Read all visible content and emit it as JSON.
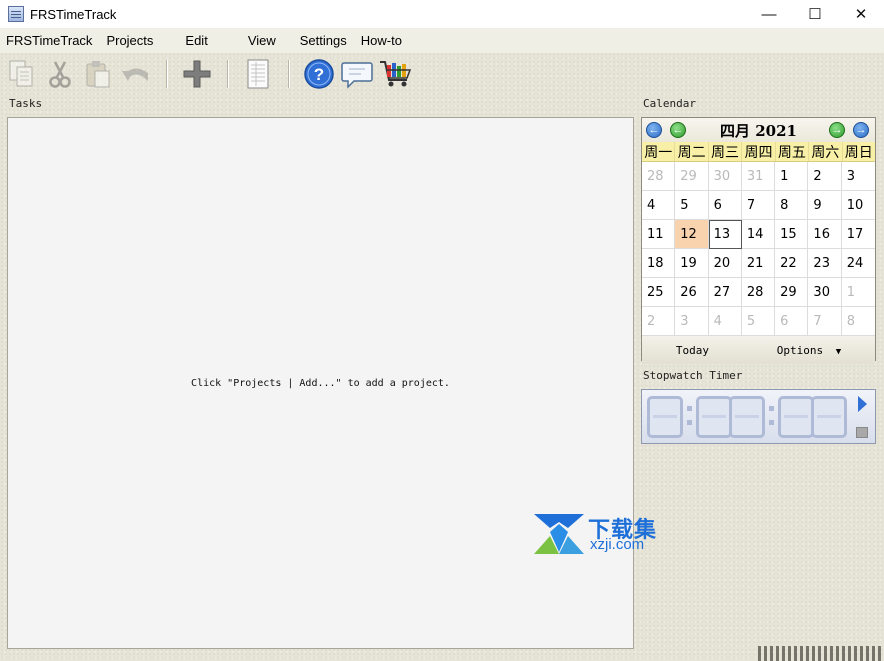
{
  "window": {
    "title": "FRSTimeTrack",
    "controls": {
      "minimize": "—",
      "maximize": "☐",
      "close": "✕"
    }
  },
  "menu": {
    "items": [
      "FRSTimeTrack",
      "Projects",
      "Edit",
      "View",
      "Settings",
      "How-to"
    ]
  },
  "toolbar": {
    "icons": [
      "copy-icon",
      "cut-icon",
      "paste-icon",
      "undo-icon",
      "add-icon",
      "report-icon",
      "help-icon",
      "feedback-icon",
      "cart-icon"
    ]
  },
  "tasks": {
    "label": "Tasks",
    "hint": "Click \"Projects | Add...\" to add a project."
  },
  "calendar": {
    "label": "Calendar",
    "title": "四月 2021",
    "weekdays": [
      "周一",
      "周二",
      "周三",
      "周四",
      "周五",
      "周六",
      "周日"
    ],
    "weeks": [
      [
        "28",
        "29",
        "30",
        "31",
        "1",
        "2",
        "3"
      ],
      [
        "4",
        "5",
        "6",
        "7",
        "8",
        "9",
        "10"
      ],
      [
        "11",
        "12",
        "13",
        "14",
        "15",
        "16",
        "17"
      ],
      [
        "18",
        "19",
        "20",
        "21",
        "22",
        "23",
        "24"
      ],
      [
        "25",
        "26",
        "27",
        "28",
        "29",
        "30",
        "1"
      ],
      [
        "2",
        "3",
        "4",
        "5",
        "6",
        "7",
        "8"
      ]
    ],
    "selected_day": "12",
    "today_day": "13",
    "today_label": "Today",
    "options_label": "Options",
    "selected_color": "#f9d2ae",
    "weekday_bg": "#f8f0a6"
  },
  "stopwatch": {
    "label": "Stopwatch Timer"
  },
  "watermark": {
    "line1": "下载集",
    "line2": "xzji.com"
  }
}
